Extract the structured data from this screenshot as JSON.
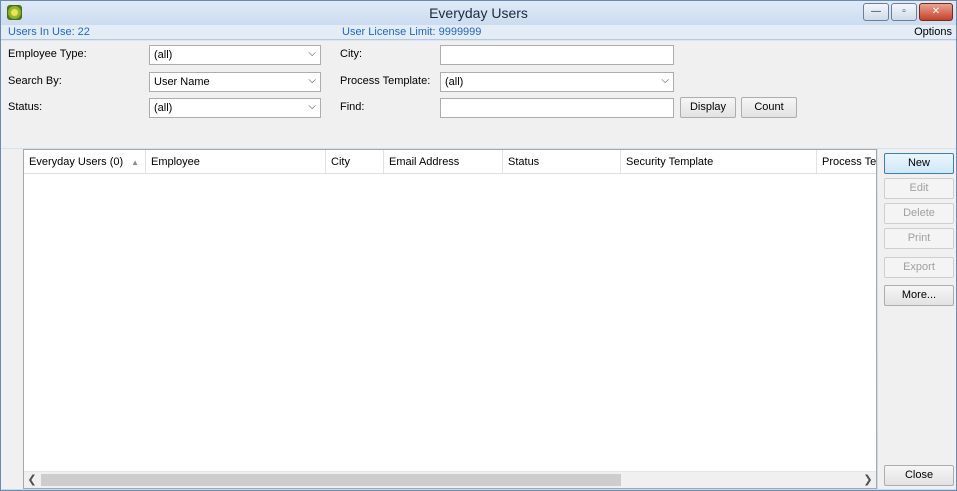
{
  "window": {
    "title": "Everyday Users",
    "controls": {
      "minimize": "—",
      "maximize": "▫",
      "close": "✕"
    }
  },
  "infobar": {
    "users_in_use": "Users In Use: 22",
    "license_limit": "User License Limit: 9999999",
    "options": "Options"
  },
  "filters": {
    "employee_type": {
      "label": "Employee Type:",
      "value": "(all)"
    },
    "search_by": {
      "label": "Search By:",
      "value": "User Name"
    },
    "status": {
      "label": "Status:",
      "value": "(all)"
    },
    "city": {
      "label": "City:",
      "value": ""
    },
    "process_template": {
      "label": "Process Template:",
      "value": "(all)"
    },
    "find": {
      "label": "Find:",
      "value": ""
    },
    "display_button": "Display",
    "count_button": "Count"
  },
  "grid": {
    "columns": [
      "Everyday Users (0)",
      "Employee",
      "City",
      "Email Address",
      "Status",
      "Security Template",
      "Process Te"
    ],
    "rows": []
  },
  "actions": {
    "new": "New",
    "edit": "Edit",
    "delete": "Delete",
    "print": "Print",
    "export": "Export",
    "more": "More...",
    "close": "Close"
  },
  "icons": {
    "sort": "sort-ascending-icon",
    "app": "app-icon"
  },
  "colors": {
    "link_blue": "#1f67c7",
    "title_bar": "#cbdcf0",
    "close_red": "#c6402a"
  }
}
